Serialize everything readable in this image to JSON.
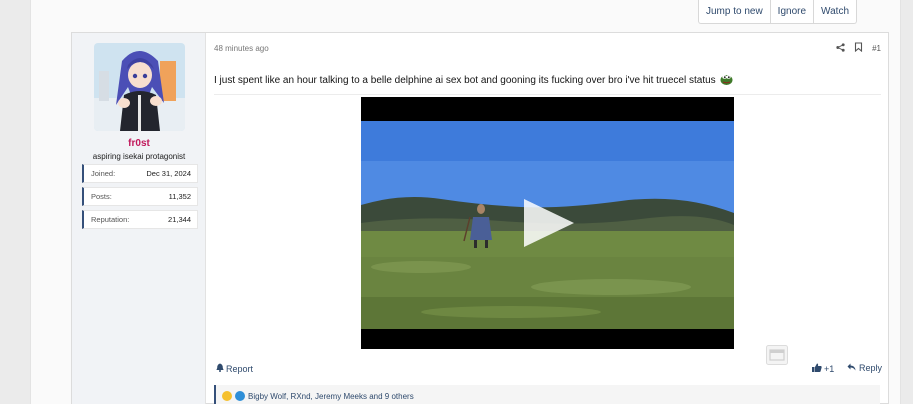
{
  "thread_controls": {
    "jump_label": "Jump to new",
    "ignore_label": "Ignore",
    "watch_label": "Watch"
  },
  "user": {
    "name": "fr0st",
    "title": "aspiring isekai protagonist",
    "stats": [
      {
        "key": "Joined:",
        "value": "Dec 31, 2024"
      },
      {
        "key": "Posts:",
        "value": "11,352"
      },
      {
        "key": "Reputation:",
        "value": "21,344"
      }
    ]
  },
  "post": {
    "timestamp": "48 minutes ago",
    "post_number": "#1",
    "message": "I just spent like an hour talking to a belle delphine ai sex bot and gooning its fucking over bro i've hit truecel status",
    "report_label": "Report",
    "like_label": "+1",
    "reply_label": "Reply",
    "reactions_text": "Bigby Wolf, RXnd, Jeremy Meeks and 9 others"
  },
  "icons": [
    "share-icon",
    "bookmark-icon",
    "pepe-emoji",
    "play-icon",
    "embed-icon",
    "bell-icon",
    "thumbs-up-icon",
    "reply-arrow-icon",
    "laugh-reaction-icon",
    "info-reaction-icon"
  ],
  "colors": {
    "username": "#c1185b",
    "link": "#2f4a6d",
    "accent_border": "#35507a"
  }
}
